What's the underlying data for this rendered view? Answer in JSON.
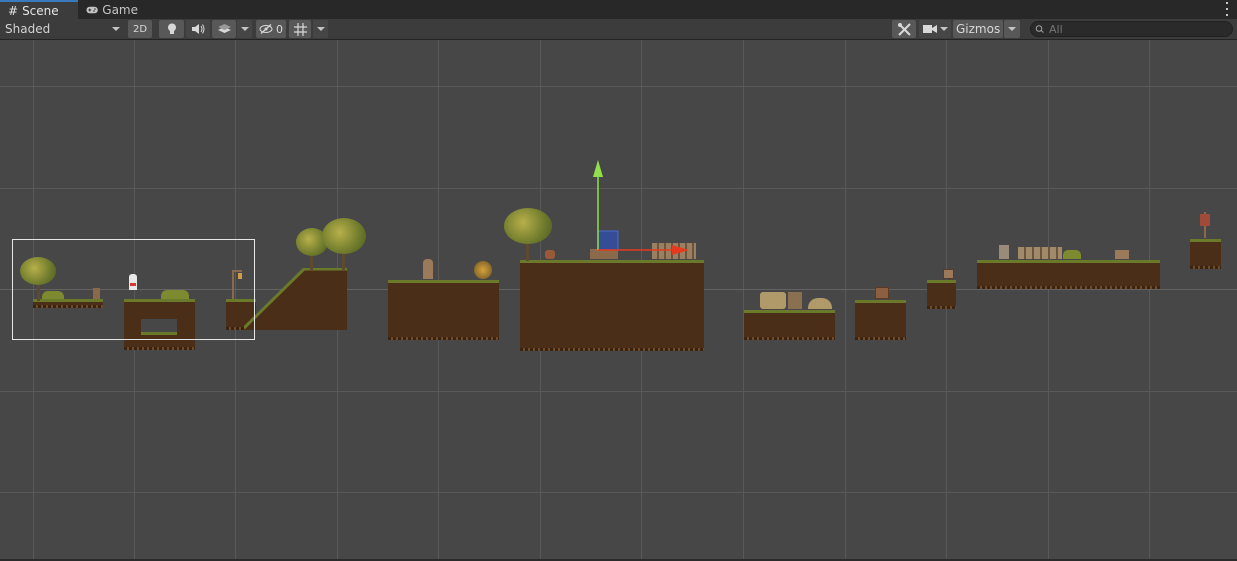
{
  "tabs": [
    {
      "label": "Scene",
      "icon": "grid-hash-icon",
      "active": true
    },
    {
      "label": "Game",
      "icon": "gamepad-icon",
      "active": false
    }
  ],
  "toolbar": {
    "draw_mode": "Shaded",
    "two_d_label": "2D",
    "hidden_count": "0",
    "gizmos_label": "Gizmos",
    "search_placeholder": "All"
  },
  "colors": {
    "tab_bar": "#282828",
    "toolbar": "#3c3c3c",
    "viewport": "#474747",
    "grid": "#595959",
    "dirt": "#4a2e17",
    "grass": "#6a7a2a",
    "active_tab_accent": "#3a79bb",
    "gizmo_y": "#8fe04a",
    "gizmo_x": "#e53a1e",
    "gizmo_plane": "#2f4fb0"
  },
  "scene": {
    "selected_object": "move-tool-gizmo"
  }
}
